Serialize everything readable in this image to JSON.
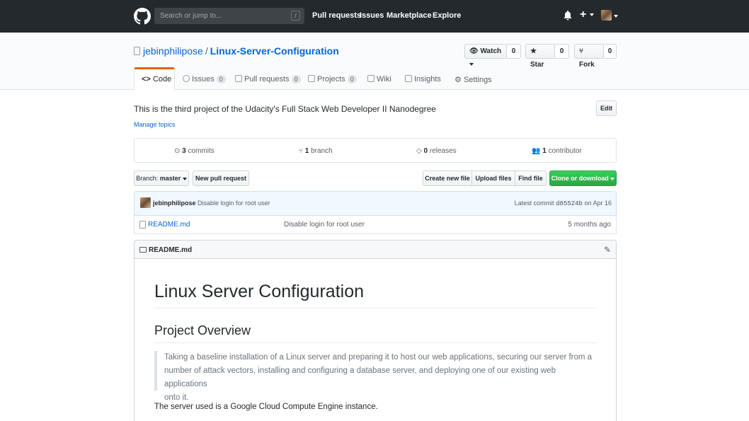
{
  "header": {
    "search_placeholder": "Search or jump to...",
    "search_key": "/",
    "nav": [
      "Pull requests",
      "Issues",
      "Marketplace",
      "Explore"
    ]
  },
  "repo": {
    "owner": "jebinphilipose",
    "separator": "/",
    "name": "Linux-Server-Configuration",
    "actions": {
      "watch": {
        "label": "Watch",
        "count": "0"
      },
      "star": {
        "label": "Star",
        "count": "0"
      },
      "fork": {
        "label": "Fork",
        "count": "0"
      }
    },
    "tabs": [
      {
        "label": "Code"
      },
      {
        "label": "Issues",
        "count": "0"
      },
      {
        "label": "Pull requests",
        "count": "0"
      },
      {
        "label": "Projects",
        "count": "0"
      },
      {
        "label": "Wiki"
      },
      {
        "label": "Insights"
      },
      {
        "label": "Settings"
      }
    ]
  },
  "main": {
    "description": "This is the third project of the Udacity's Full Stack Web Developer II Nanodegree",
    "edit_label": "Edit",
    "manage_topics": "Manage topics",
    "summary": {
      "commits_count": "3",
      "commits_label": "commits",
      "branch_count": "1",
      "branch_label": "branch",
      "releases_count": "0",
      "releases_label": "releases",
      "contributor_count": "1",
      "contributor_label": "contributor"
    },
    "branch_label": "Branch:",
    "branch_value": "master",
    "new_pr": "New pull request",
    "create_file": "Create new file",
    "upload_files": "Upload files",
    "find_file": "Find file",
    "clone": "Clone or download",
    "commit": {
      "author": "jebinphilipose",
      "message": "Disable login for root user",
      "latest_label": "Latest commit",
      "sha": "d85524b",
      "date": "on Apr 16"
    },
    "files": [
      {
        "name": "README.md",
        "message": "Disable login for root user",
        "age": "5 months ago"
      }
    ]
  },
  "readme": {
    "title": "README.md",
    "h1": "Linux Server Configuration",
    "h2": "Project Overview",
    "quote_lines": [
      "Taking a baseline installation of a Linux server and preparing it to host our web applications, securing our server from a",
      "number of attack vectors, installing and configuring a database server, and deploying one of our existing web applications",
      "onto it."
    ],
    "paragraph": "The server used is a Google Cloud Compute Engine instance."
  },
  "colors": {
    "header_bg": "#24292e",
    "link": "#0366d6",
    "active_tab_accent": "#e36209",
    "clone_button": "#28a745"
  }
}
